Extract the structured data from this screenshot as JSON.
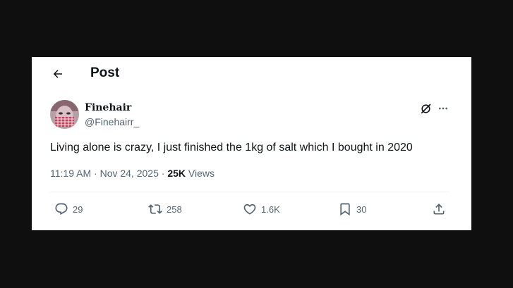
{
  "header": {
    "title": "Post",
    "back_icon": "arrow-left-icon"
  },
  "author": {
    "display_name": "Finehair",
    "handle": "@Finehairr_",
    "avatar": "avatar-image"
  },
  "tweet": {
    "text": "Living alone is crazy, I just finished the 1kg of salt which I bought in 2020",
    "time": "11:19 AM",
    "separator": " · ",
    "date": "Nov 24, 2025",
    "views_count": "25K",
    "views_label": " Views"
  },
  "actions": {
    "replies": "29",
    "reposts": "258",
    "likes": "1.6K",
    "bookmarks": "30"
  },
  "colors": {
    "text_primary": "#0f1419",
    "text_secondary": "#536471",
    "divider": "#eff3f4",
    "background": "#0f0f0f"
  }
}
